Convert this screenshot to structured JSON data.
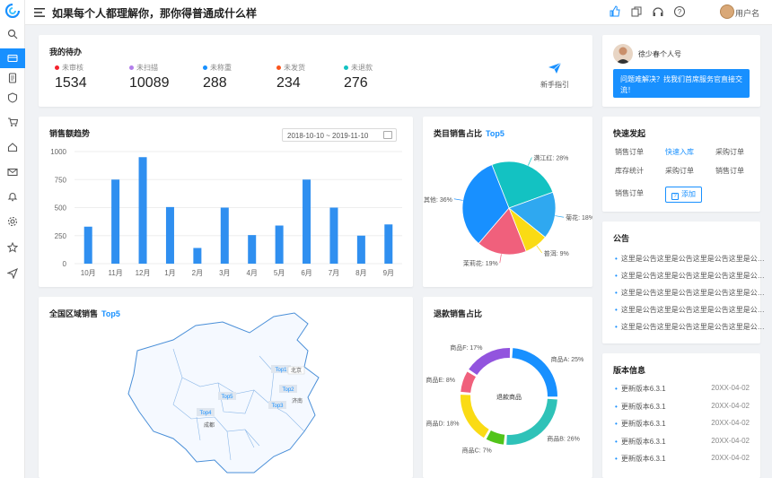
{
  "header": {
    "title": "如果每个人都理解你，那你得普通成什么样",
    "username": "用户名",
    "icons": [
      "thumbs-up-icon",
      "copy-icon",
      "headset-icon",
      "help-icon"
    ]
  },
  "sidebar": {
    "items": [
      "search-icon",
      "card-icon",
      "document-icon",
      "shield-icon",
      "cart-icon",
      "home-icon",
      "mail-icon",
      "bell-icon",
      "settings-icon",
      "star-icon",
      "send-icon"
    ],
    "active_index": 1
  },
  "todo": {
    "title": "我的待办",
    "items": [
      {
        "label": "未审核",
        "value": "1534",
        "color": "#f5222d"
      },
      {
        "label": "未扫描",
        "value": "10089",
        "color": "#b37feb"
      },
      {
        "label": "未称重",
        "value": "288",
        "color": "#1890ff"
      },
      {
        "label": "未发货",
        "value": "234",
        "color": "#fa541c"
      },
      {
        "label": "未退款",
        "value": "276",
        "color": "#13c2c2"
      }
    ],
    "guide_label": "新手指引"
  },
  "profile": {
    "name": "徐少春个人号",
    "cta": "问题难解决？找我们首席服务官直接交流！"
  },
  "sales_trend": {
    "title": "销售额趋势",
    "date_range": "2018-10-10 ~ 2019-11-10",
    "chart_data": {
      "type": "bar",
      "categories": [
        "10月",
        "11月",
        "12月",
        "1月",
        "2月",
        "3月",
        "4月",
        "5月",
        "6月",
        "7月",
        "8月",
        "9月"
      ],
      "series": [
        {
          "values": [
            330,
            750,
            950,
            505,
            140,
            500,
            255,
            340,
            750,
            500,
            250,
            350
          ]
        }
      ],
      "ylim": [
        0,
        1000
      ],
      "yticks": [
        0,
        250,
        500,
        750,
        1000
      ],
      "grid": true,
      "color": "#2f8ff0"
    }
  },
  "category_share": {
    "title": "类目销售占比",
    "top5": "Top5",
    "chart_data": {
      "type": "pie",
      "slices": [
        {
          "label": "满江红",
          "value": 28,
          "display": "28%",
          "color": "#13c2c2"
        },
        {
          "label": "菊花",
          "value": 18,
          "display": "18%",
          "color": "#2fa8f0"
        },
        {
          "label": "普洱",
          "value": 9,
          "display": "9%",
          "color": "#fadb14"
        },
        {
          "label": "茉莉花",
          "value": 19,
          "display": "19%",
          "color": "#f0607c"
        },
        {
          "label": "其他",
          "value": 36,
          "display": "36%",
          "color": "#1890ff"
        }
      ]
    }
  },
  "quick_launch": {
    "title": "快速发起",
    "links": [
      "销售订单",
      "快速入库",
      "采购订单",
      "库存统计",
      "采购订单",
      "销售订单",
      "销售订单"
    ],
    "add_label": "添加"
  },
  "notices": {
    "title": "公告",
    "items": [
      "这里是公告这里是公告这里是公告这里是公…",
      "这里是公告这里是公告这里是公告这里是公…",
      "这里是公告这里是公告这里是公告这里是公…",
      "这里是公告这里是公告这里是公告这里是公…",
      "这里是公告这里是公告这里是公告这里是公…"
    ]
  },
  "region": {
    "title": "全国区域销售",
    "top5": "Top5",
    "map_labels": [
      "Top1",
      "北京",
      "Top2",
      "Top3",
      "Top4",
      "Top5",
      "成都",
      "济南"
    ]
  },
  "refund_share": {
    "title": "退款销售占比",
    "center": "退款商品",
    "chart_data": {
      "type": "pie",
      "donut": true,
      "slices": [
        {
          "label": "商品A",
          "value": 25,
          "display": "25%",
          "color": "#1890ff"
        },
        {
          "label": "商品B",
          "value": 26,
          "display": "26%",
          "color": "#2fc2b8"
        },
        {
          "label": "商品C",
          "value": 7,
          "display": "7%",
          "color": "#52c41a"
        },
        {
          "label": "商品D",
          "value": 18,
          "display": "18%",
          "color": "#fadb14"
        },
        {
          "label": "商品E",
          "value": 8,
          "display": "8%",
          "color": "#f0607c"
        },
        {
          "label": "商品F",
          "value": 17,
          "display": "17%",
          "color": "#9254de"
        }
      ]
    }
  },
  "versions": {
    "title": "版本信息",
    "items": [
      {
        "label": "更新版本6.3.1",
        "date": "20XX-04-02"
      },
      {
        "label": "更新版本6.3.1",
        "date": "20XX-04-02"
      },
      {
        "label": "更新版本6.3.1",
        "date": "20XX-04-02"
      },
      {
        "label": "更新版本6.3.1",
        "date": "20XX-04-02"
      },
      {
        "label": "更新版本6.3.1",
        "date": "20XX-04-02"
      }
    ]
  }
}
